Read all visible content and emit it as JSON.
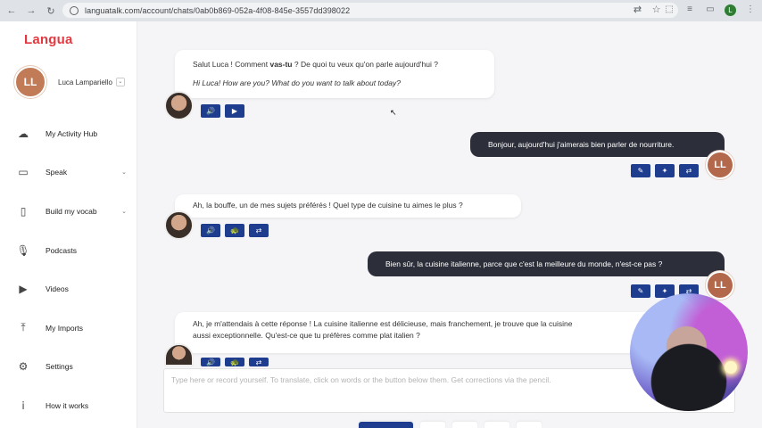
{
  "browser": {
    "url": "languatalk.com/account/chats/0ab0b869-052a-4f08-845e-3557dd398022",
    "profile_initial": "L"
  },
  "sidebar": {
    "logo": "Langua",
    "user": {
      "initials": "LL",
      "name": "Luca Lampariello"
    },
    "items": [
      {
        "label": "My Activity Hub",
        "icon": "cloud-icon"
      },
      {
        "label": "Speak",
        "icon": "chat-icon",
        "has_caret": true
      },
      {
        "label": "Build my vocab",
        "icon": "book-icon",
        "has_caret": true
      },
      {
        "label": "Podcasts",
        "icon": "microphone-icon"
      },
      {
        "label": "Videos",
        "icon": "video-icon"
      },
      {
        "label": "My Imports",
        "icon": "upload-icon"
      },
      {
        "label": "Settings",
        "icon": "gear-icon"
      },
      {
        "label": "How it works",
        "icon": "info-icon"
      }
    ]
  },
  "chat": {
    "messages": [
      {
        "role": "bot",
        "text_before": "Salut Luca ! Comment ",
        "text_bold": "vas-tu",
        "text_after": " ? De quoi tu veux qu'on parle aujourd'hui ?",
        "translation": "Hi Luca! How are you? What do you want to talk about today?"
      },
      {
        "role": "user",
        "text": "Bonjour, aujourd'hui j'aimerais bien parler de nourriture.",
        "initials": "LL"
      },
      {
        "role": "bot",
        "text": "Ah, la bouffe, un de mes sujets préférés ! Quel type de cuisine tu aimes le plus ?"
      },
      {
        "role": "user",
        "text": "Bien sûr, la cuisine italienne, parce que c'est la meilleure du monde, n'est-ce pas ?",
        "initials": "LL"
      },
      {
        "role": "bot",
        "line1": "Ah, je m'attendais à cette réponse ! La cuisine italienne est délicieuse, mais franchement, je trouve que la cuisine",
        "line2": "aussi exceptionnelle. Qu'est-ce que tu préfères comme plat italien ?"
      }
    ],
    "input_placeholder": "Type here or record yourself. To translate, click on words or the button below them. Get corrections via the pencil."
  }
}
